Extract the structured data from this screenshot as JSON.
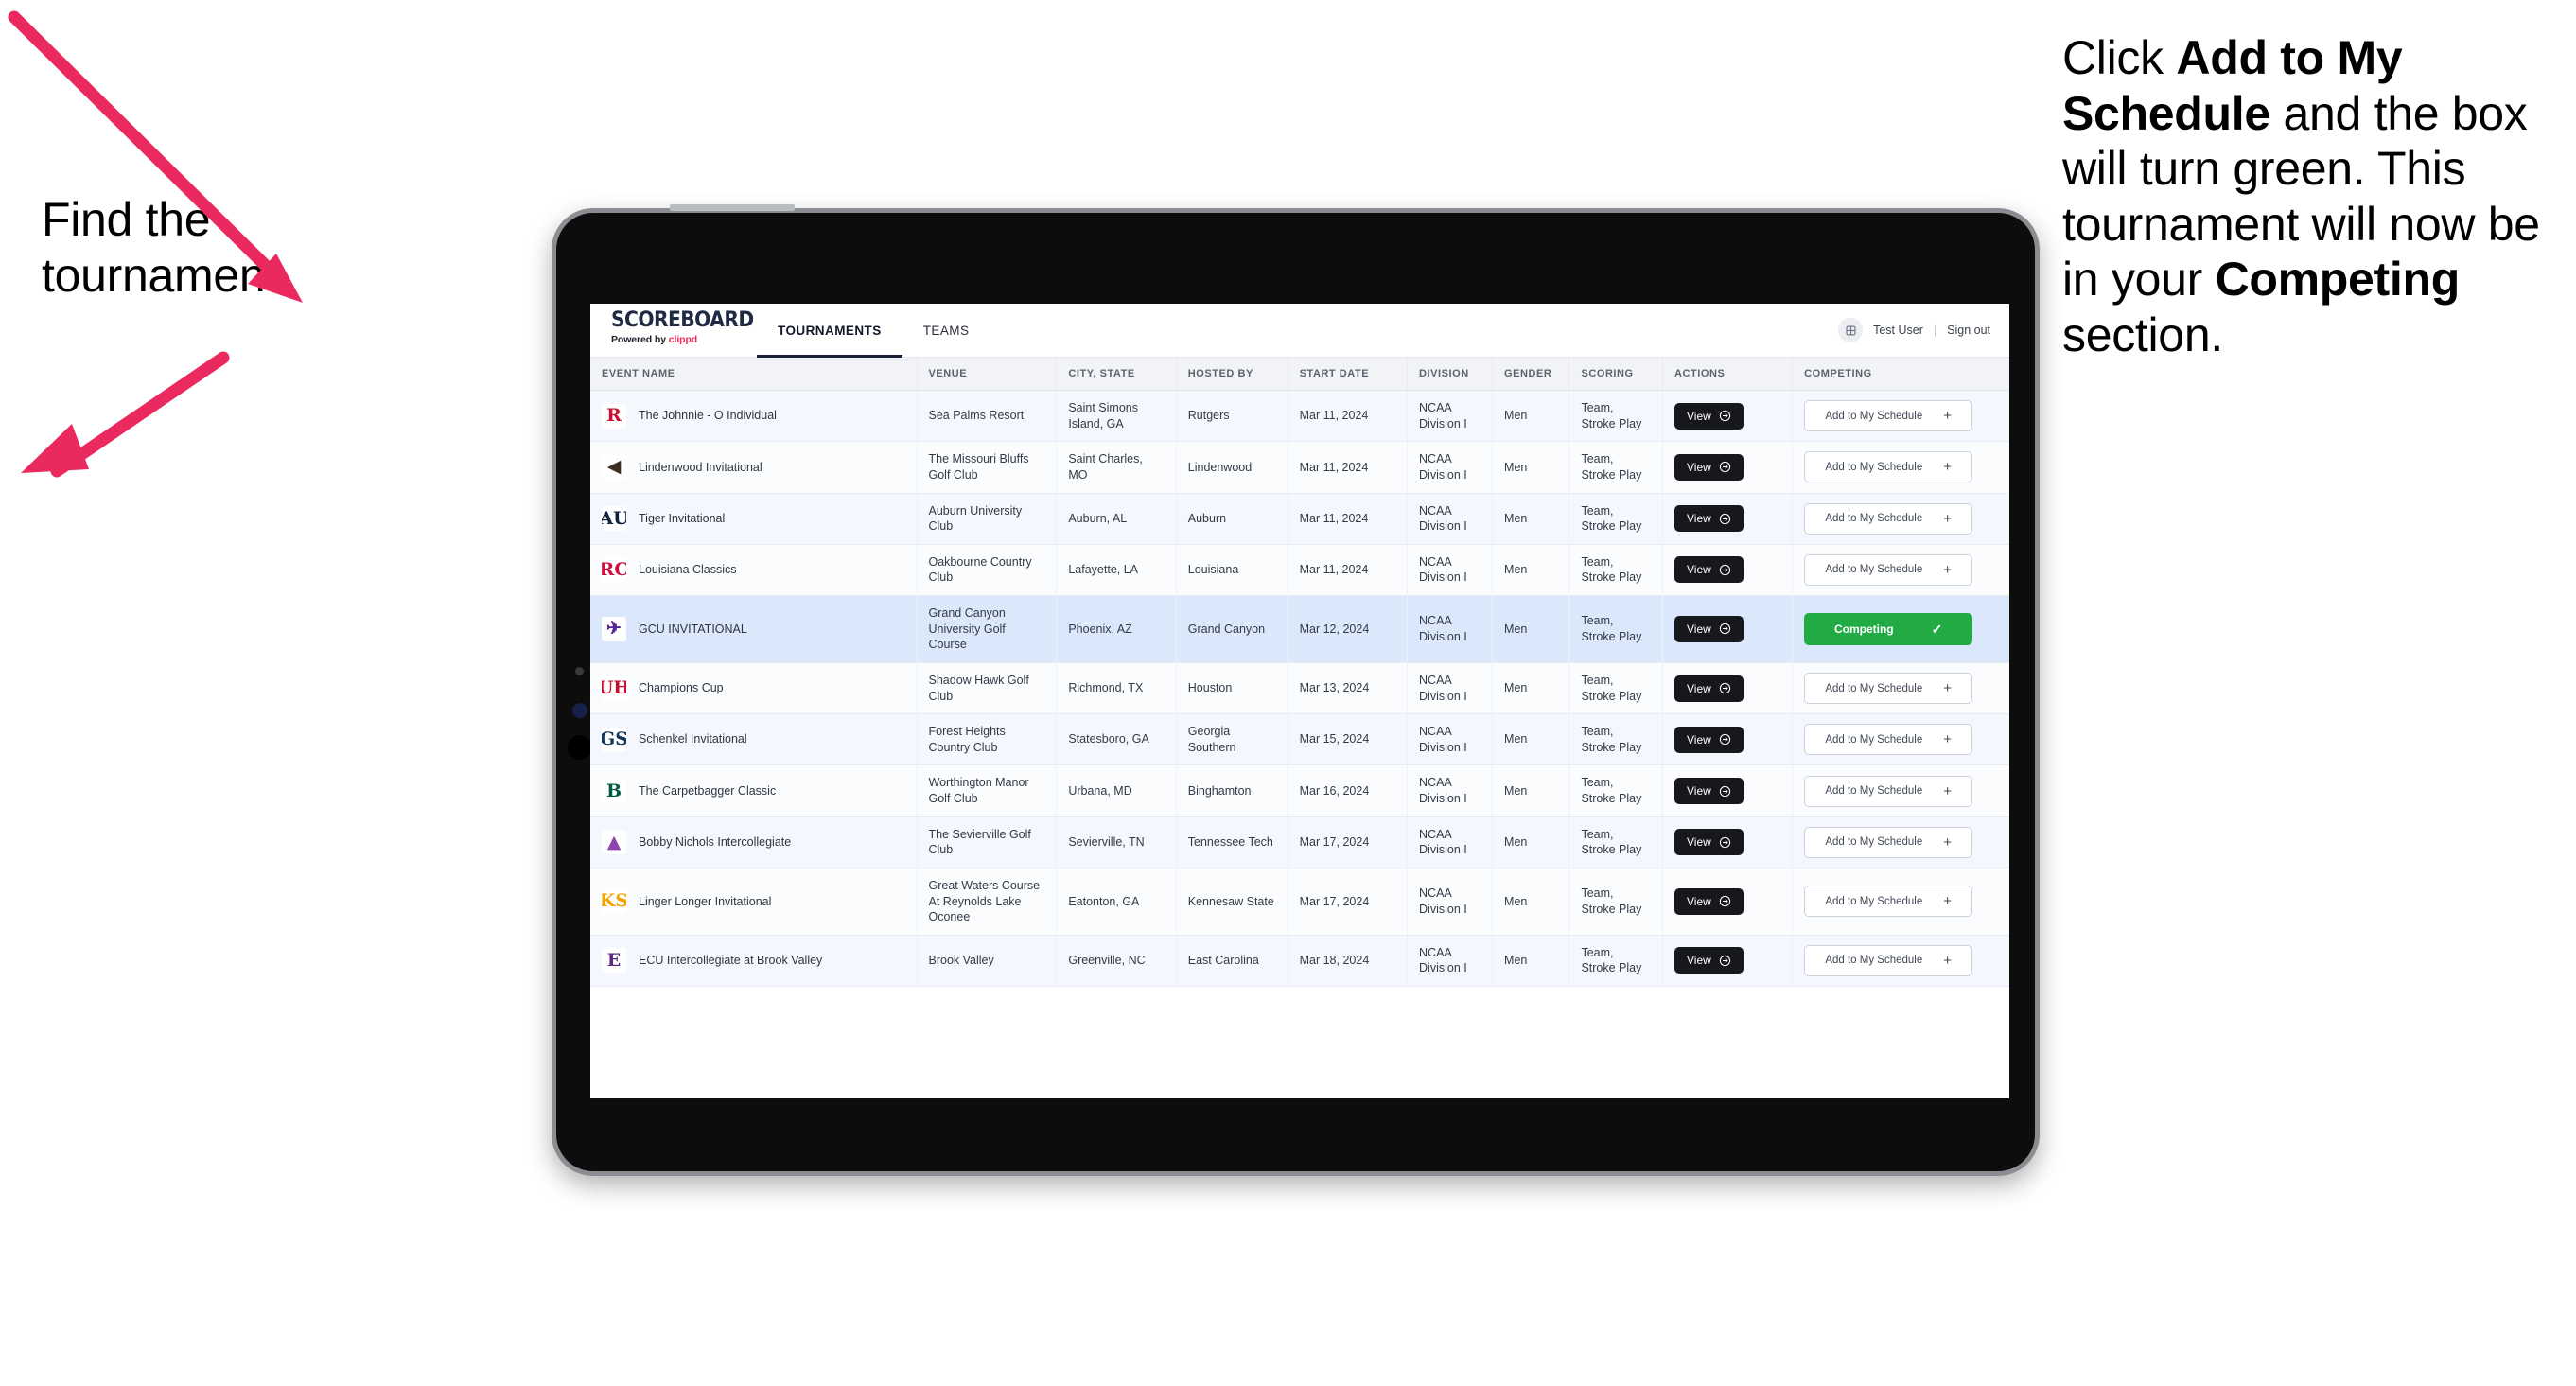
{
  "annotations": {
    "left": {
      "line1": "Find the",
      "line2": "tournament."
    },
    "right": {
      "p1_pre": "Click ",
      "p1_bold": "Add to My Schedule",
      "p1_post": " and the box will turn green. This tournament will now be in your ",
      "p2_bold": "Competing",
      "p2_post": " section."
    }
  },
  "app": {
    "brand": {
      "title": "SCOREBOARD",
      "powered_prefix": "Powered by ",
      "powered_brand": "clippd"
    },
    "nav": [
      {
        "label": "TOURNAMENTS",
        "active": true
      },
      {
        "label": "TEAMS",
        "active": false
      }
    ],
    "user": {
      "name": "Test User",
      "separator": "|",
      "signout": "Sign out",
      "avatar_icon": "user-avatar-icon"
    }
  },
  "table": {
    "columns": [
      "EVENT NAME",
      "VENUE",
      "CITY, STATE",
      "HOSTED BY",
      "START DATE",
      "DIVISION",
      "GENDER",
      "SCORING",
      "ACTIONS",
      "COMPETING"
    ],
    "labels": {
      "view": "View",
      "add": "Add to My Schedule",
      "add_icon": "plus-icon",
      "competing": "Competing",
      "competing_icon": "check-icon",
      "view_icon": "arrow-circle-right-icon"
    },
    "rows": [
      {
        "logo": "R",
        "logo_color": "#c8102e",
        "logo_bg": "#ffffff",
        "event": "The Johnnie - O Individual",
        "venue": "Sea Palms Resort",
        "city": "Saint Simons Island, GA",
        "host": "Rutgers",
        "date": "Mar 11, 2024",
        "division": "NCAA Division I",
        "gender": "Men",
        "scoring": "Team, Stroke Play",
        "competing": false
      },
      {
        "logo": "◀",
        "logo_color": "#3b2f22",
        "logo_bg": "#ffffff",
        "event": "Lindenwood Invitational",
        "venue": "The Missouri Bluffs Golf Club",
        "city": "Saint Charles, MO",
        "host": "Lindenwood",
        "date": "Mar 11, 2024",
        "division": "NCAA Division I",
        "gender": "Men",
        "scoring": "Team, Stroke Play",
        "competing": false
      },
      {
        "logo": "AU",
        "logo_color": "#0c2340",
        "logo_bg": "#ffffff",
        "event": "Tiger Invitational",
        "venue": "Auburn University Club",
        "city": "Auburn, AL",
        "host": "Auburn",
        "date": "Mar 11, 2024",
        "division": "NCAA Division I",
        "gender": "Men",
        "scoring": "Team, Stroke Play",
        "competing": false
      },
      {
        "logo": "RC",
        "logo_color": "#ce0f3d",
        "logo_bg": "#ffffff",
        "event": "Louisiana Classics",
        "venue": "Oakbourne Country Club",
        "city": "Lafayette, LA",
        "host": "Louisiana",
        "date": "Mar 11, 2024",
        "division": "NCAA Division I",
        "gender": "Men",
        "scoring": "Team, Stroke Play",
        "competing": false
      },
      {
        "logo": "✈",
        "logo_color": "#522398",
        "logo_bg": "#ffffff",
        "event": "GCU INVITATIONAL",
        "venue": "Grand Canyon University Golf Course",
        "city": "Phoenix, AZ",
        "host": "Grand Canyon",
        "date": "Mar 12, 2024",
        "division": "NCAA Division I",
        "gender": "Men",
        "scoring": "Team, Stroke Play",
        "competing": true,
        "selected": true
      },
      {
        "logo": "UH",
        "logo_color": "#c8102e",
        "logo_bg": "#ffffff",
        "event": "Champions Cup",
        "venue": "Shadow Hawk Golf Club",
        "city": "Richmond, TX",
        "host": "Houston",
        "date": "Mar 13, 2024",
        "division": "NCAA Division I",
        "gender": "Men",
        "scoring": "Team, Stroke Play",
        "competing": false
      },
      {
        "logo": "GS",
        "logo_color": "#12355b",
        "logo_bg": "#ffffff",
        "event": "Schenkel Invitational",
        "venue": "Forest Heights Country Club",
        "city": "Statesboro, GA",
        "host": "Georgia Southern",
        "date": "Mar 15, 2024",
        "division": "NCAA Division I",
        "gender": "Men",
        "scoring": "Team, Stroke Play",
        "competing": false
      },
      {
        "logo": "B",
        "logo_color": "#005a43",
        "logo_bg": "#ffffff",
        "event": "The Carpetbagger Classic",
        "venue": "Worthington Manor Golf Club",
        "city": "Urbana, MD",
        "host": "Binghamton",
        "date": "Mar 16, 2024",
        "division": "NCAA Division I",
        "gender": "Men",
        "scoring": "Team, Stroke Play",
        "competing": false
      },
      {
        "logo": "▲",
        "logo_color": "#8e44ad",
        "logo_bg": "#ffffff",
        "event": "Bobby Nichols Intercollegiate",
        "venue": "The Sevierville Golf Club",
        "city": "Sevierville, TN",
        "host": "Tennessee Tech",
        "date": "Mar 17, 2024",
        "division": "NCAA Division I",
        "gender": "Men",
        "scoring": "Team, Stroke Play",
        "competing": false
      },
      {
        "logo": "KS",
        "logo_color": "#f0a500",
        "logo_bg": "#ffffff",
        "event": "Linger Longer Invitational",
        "venue": "Great Waters Course At Reynolds Lake Oconee",
        "city": "Eatonton, GA",
        "host": "Kennesaw State",
        "date": "Mar 17, 2024",
        "division": "NCAA Division I",
        "gender": "Men",
        "scoring": "Team, Stroke Play",
        "competing": false
      },
      {
        "logo": "E",
        "logo_color": "#5b2b82",
        "logo_bg": "#ffffff",
        "event": "ECU Intercollegiate at Brook Valley",
        "venue": "Brook Valley",
        "city": "Greenville, NC",
        "host": "East Carolina",
        "date": "Mar 18, 2024",
        "division": "NCAA Division I",
        "gender": "Men",
        "scoring": "Team, Stroke Play",
        "competing": false,
        "clipped": true
      }
    ]
  },
  "colors": {
    "arrow": "#ea2a5f",
    "competing_green": "#22ab45",
    "selected_row": "#dbe8fb",
    "brand_pink": "#f0285a"
  }
}
